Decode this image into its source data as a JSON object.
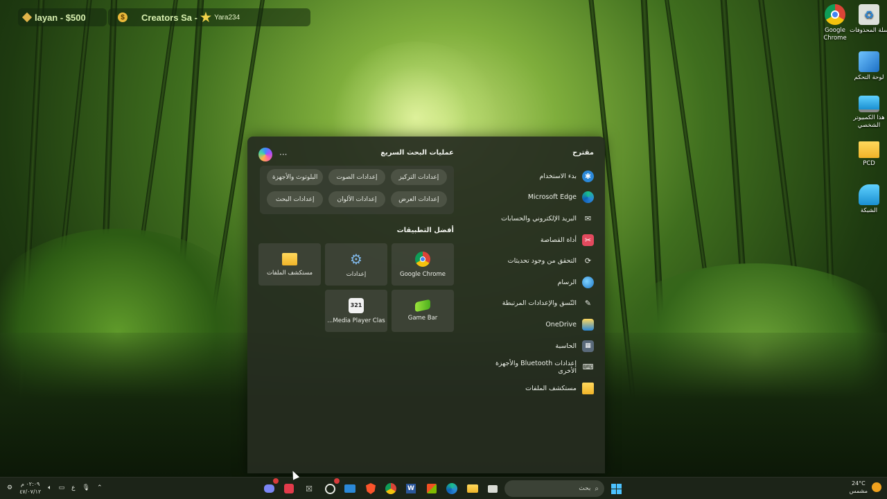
{
  "widgets": {
    "balance_text": "layan - $500",
    "creators_text": "Creators Sa -",
    "username": "Yara234",
    "coin_glyph": "$"
  },
  "desktop_icons": [
    {
      "label": "Google Chrome",
      "icon": "chrome-icon"
    },
    {
      "label": "سلة المحذوفات",
      "icon": "recycle-bin-icon"
    },
    {
      "label": "لوحة التحكم",
      "icon": "control-panel-icon"
    },
    {
      "label": "هذا الكمبيوتر الشخصي",
      "icon": "this-pc-icon"
    },
    {
      "label": "PCD",
      "icon": "folder-icon"
    },
    {
      "label": "الشبكة",
      "icon": "network-icon"
    }
  ],
  "start_menu": {
    "suggested_title": "مقترح",
    "suggested": [
      {
        "label": "بدء الاستخدام",
        "icon": "get-started-icon"
      },
      {
        "label": "Microsoft Edge",
        "icon": "edge-icon"
      },
      {
        "label": "البريد الإلكتروني والحسابات",
        "icon": "mail-icon"
      },
      {
        "label": "أداة القصاصة",
        "icon": "snipping-tool-icon"
      },
      {
        "label": "التحقق من وجود تحديثات",
        "icon": "update-icon"
      },
      {
        "label": "الرسام",
        "icon": "paint-icon"
      },
      {
        "label": "النّسق والإعدادات المرتبطة",
        "icon": "pen-icon"
      },
      {
        "label": "OneDrive",
        "icon": "onedrive-icon"
      },
      {
        "label": "الحاسبة",
        "icon": "calculator-icon"
      },
      {
        "label": "إعدادات Bluetooth والأجهزة الأخرى",
        "icon": "bluetooth-devices-icon"
      },
      {
        "label": "مستكشف الملفات",
        "icon": "file-explorer-icon"
      }
    ],
    "quick_search_title": "عمليات البحث السريع",
    "more_glyph": "···",
    "quick_search_chips": [
      "إعدادات التركيز",
      "إعدادات الصوت",
      "البلوتوث والأجهزة",
      "إعدادات العرض",
      "إعدادات الألوان",
      "إعدادات البحث"
    ],
    "top_apps_title": "أفضل التطبيقات",
    "top_apps": [
      {
        "label": "Google Chrome",
        "icon": "chrome-icon"
      },
      {
        "label": "إعدادات",
        "icon": "settings-gear-icon"
      },
      {
        "label": "مستكشف الملفات",
        "icon": "file-explorer-icon"
      },
      {
        "label": "Game Bar",
        "icon": "game-bar-icon"
      },
      {
        "label": "Media Player Clas...",
        "icon": "media-player-icon"
      }
    ]
  },
  "taskbar": {
    "search_placeholder": "بحث",
    "weather_temp": "24°C",
    "weather_desc": "مشمس",
    "clock_time": "٠٢:٠٩ م",
    "clock_date": "٤٧/٠٧/١٢",
    "lang": "ع",
    "apps": [
      "start-icon",
      "file-explorer-icon",
      "edge-icon",
      "store-icon",
      "word-icon",
      "chrome-icon",
      "brave-icon",
      "mail-icon",
      "clock-icon",
      "close-box-icon",
      "roblox-icon",
      "discord-icon"
    ]
  },
  "colors": {
    "menu_bg": "#262c20",
    "accent": "#2b88d8",
    "sun": "#f0a21e"
  }
}
